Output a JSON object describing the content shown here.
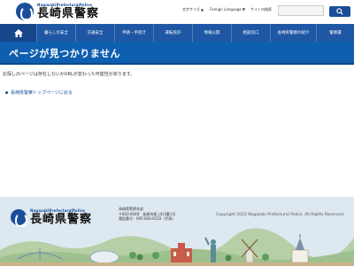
{
  "header": {
    "logo_sub": "NagasakiPrefecturalPolice",
    "logo_main": "長崎県警察",
    "text_size_label": "文字サイズ",
    "language_label": "Foreign Language",
    "site_search_label": "サイト内検索",
    "search_placeholder": "",
    "search_icon": "search-icon"
  },
  "nav": {
    "home_icon": "home-icon",
    "items": [
      "暮らしの安全",
      "交通安全",
      "申請・手続き",
      "運転免許",
      "情報公開",
      "相談窓口",
      "長崎県警察の紹介",
      "警察署"
    ]
  },
  "main": {
    "title": "ページが見つかりません",
    "message": "お探しのページは存在しないかURLが変わった可能性があります。",
    "back_link": "長崎県警察トップページに戻る"
  },
  "footer": {
    "logo_sub": "NagasakiPrefecturalPolice",
    "logo_main": "長崎県警察",
    "address_1": "長崎県警察本部",
    "address_2": "〒850-8548　長崎市尾上町3番1号",
    "address_3": "電話番号：095-820-0110（代表）",
    "copyright": "Copyright 2022 Nagasaki Prefectural Police. All Rights Reserved."
  },
  "colors": {
    "nav_bg": "#1f57a4",
    "title_bg": "#0f5fb0",
    "footer_bg": "#dde8f0",
    "brand": "#1a4e9a"
  }
}
